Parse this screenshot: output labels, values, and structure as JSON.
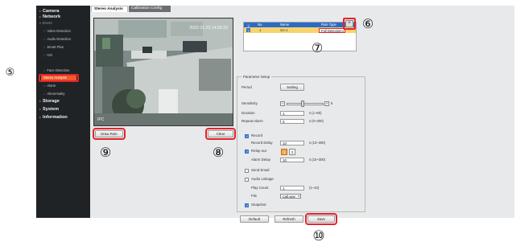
{
  "sidebar": {
    "items": [
      {
        "label": "Camera",
        "level": 1
      },
      {
        "label": "Network",
        "level": 1
      },
      {
        "label": "Event",
        "level": 2
      },
      {
        "label": "Video Detection",
        "level": 3
      },
      {
        "label": "Audio Detection",
        "level": 3
      },
      {
        "label": "Smart Plan",
        "level": 3
      },
      {
        "label": "IVS",
        "level": 3
      },
      {
        "label": "Face Detection",
        "level": 3
      },
      {
        "label": "Stereo Analysis",
        "level": 3,
        "active": true
      },
      {
        "label": "Alarm",
        "level": 3
      },
      {
        "label": "Abnormality",
        "level": 3
      },
      {
        "label": "Storage",
        "level": 1
      },
      {
        "label": "System",
        "level": 1
      },
      {
        "label": "Information",
        "level": 1
      }
    ]
  },
  "tabs": [
    "Stereo Analysis",
    "Calibration Config"
  ],
  "video": {
    "timestamp": "2022-11-23 14:59:23",
    "cam_label": "IPC"
  },
  "buttons": {
    "draw_rule": "Draw Rule",
    "clear": "Clear",
    "default": "Default",
    "refresh": "Refresh",
    "save": "Save",
    "setting": "Setting",
    "add": "+"
  },
  "rule_table": {
    "columns": [
      "No.",
      "Name",
      "Rule Type"
    ],
    "rows": [
      {
        "no": "1",
        "name": "SA-1",
        "rule_type": "Fall Detection"
      }
    ]
  },
  "parameter_setup": {
    "title": "Parameter Setup",
    "period_label": "Period",
    "sensitivity_label": "Sensitivity",
    "sensitivity_value": "5",
    "sensitivity_level": 5,
    "duration_label": "Duration",
    "duration_value": "1",
    "duration_unit": "s (1~60)",
    "repeat_alarm_label": "Repeat Alarm",
    "repeat_alarm_value": "0",
    "repeat_alarm_unit": "s (0~300)",
    "record_label": "Record",
    "record_delay_label": "Record Delay",
    "record_delay_value": "10",
    "record_delay_unit": "s (10~300)",
    "relay_out_label": "Relay-out",
    "relay_options": [
      "1",
      "2"
    ],
    "alarm_delay_label": "Alarm Delay",
    "alarm_delay_value": "10",
    "alarm_delay_unit": "s (10~300)",
    "send_email_label": "Send Email",
    "audio_linkage_label": "Audio Linkage",
    "play_count_label": "Play Count",
    "play_count_value": "1",
    "play_count_unit": "(1~10)",
    "file_label": "File",
    "file_value": "Call.wav",
    "snapshot_label": "Snapshot"
  },
  "callouts": {
    "c5": "⑤",
    "c6": "⑥",
    "c7": "⑦",
    "c8": "⑧",
    "c9": "⑨",
    "c10": "⑩"
  },
  "colors": {
    "sidebar_bg": "#1f2326",
    "active_item": "#ee5a2a",
    "table_header": "#2b6bc4",
    "selected_row": "#f5d46e",
    "annotation_red": "#e4242c"
  }
}
